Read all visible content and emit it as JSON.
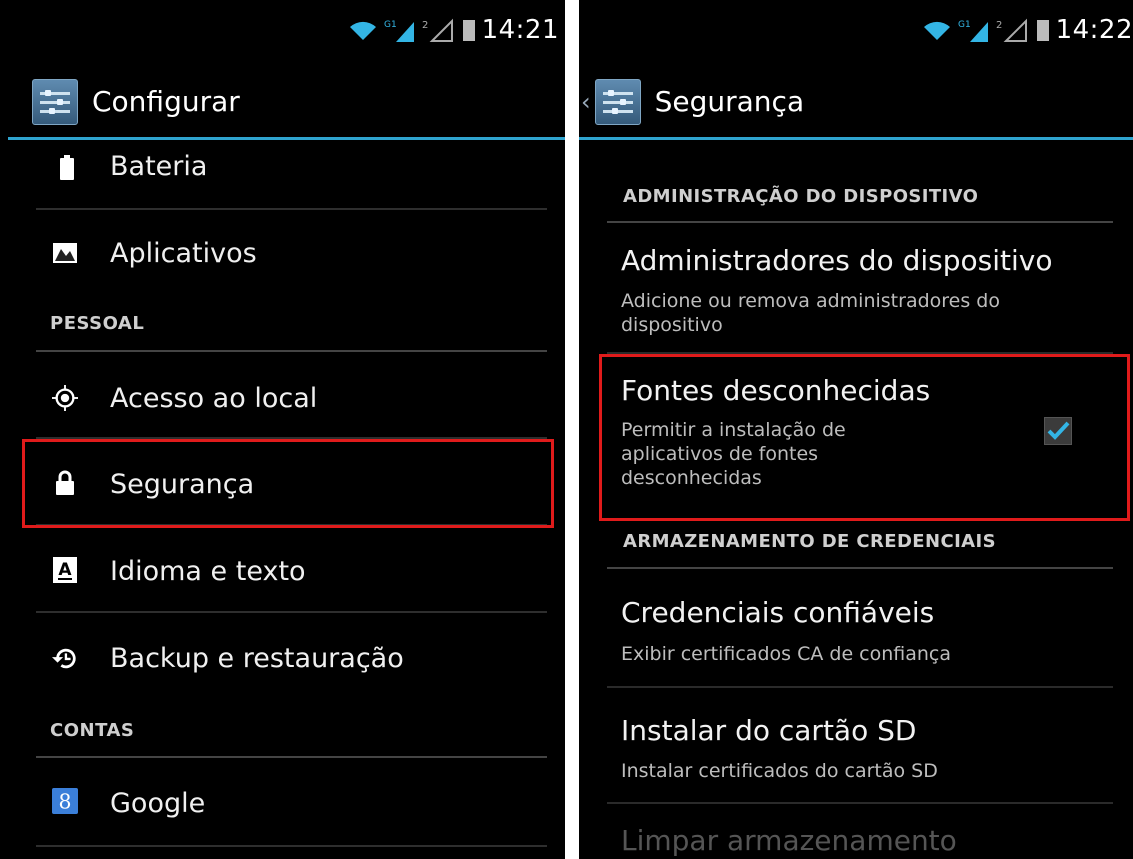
{
  "left": {
    "status": {
      "time": "14:21"
    },
    "action_bar": {
      "title": "Configurar"
    },
    "items": [
      {
        "label": "Bateria",
        "icon": "battery-icon"
      },
      {
        "label": "Aplicativos",
        "icon": "apps-icon"
      },
      {
        "label": "Acesso ao local",
        "icon": "location-icon"
      },
      {
        "label": "Segurança",
        "icon": "lock-icon"
      },
      {
        "label": "Idioma e texto",
        "icon": "language-icon"
      },
      {
        "label": "Backup e restauração",
        "icon": "backup-icon"
      },
      {
        "label": "Google",
        "icon": "google-icon"
      }
    ],
    "headers": {
      "personal": "PESSOAL",
      "accounts": "CONTAS"
    },
    "google_glyph": "8",
    "language_glyph": "A"
  },
  "right": {
    "status": {
      "time": "14:22"
    },
    "action_bar": {
      "title": "Segurança",
      "up_caret": "‹"
    },
    "section_admin": "ADMINISTRAÇÃO DO DISPOSITIVO",
    "admins": {
      "title": "Administradores do dispositivo",
      "subtitle": "Adicione ou remova administradores do dispositivo"
    },
    "unknown_sources": {
      "title": "Fontes desconhecidas",
      "subtitle": "Permitir a instalação de aplicativos de fontes desconhecidas",
      "checked": true
    },
    "section_credentials": "ARMAZENAMENTO DE CREDENCIAIS",
    "trusted": {
      "title": "Credenciais confiáveis",
      "subtitle": "Exibir certificados CA de confiança"
    },
    "install_sd": {
      "title": "Instalar do cartão SD",
      "subtitle": "Instalar certificados do cartão SD"
    },
    "clear_storage": {
      "title": "Limpar armazenamento"
    }
  },
  "colors": {
    "accent": "#2fa4cf",
    "highlight": "#e01b1b",
    "checkmark": "#33b5e5"
  }
}
